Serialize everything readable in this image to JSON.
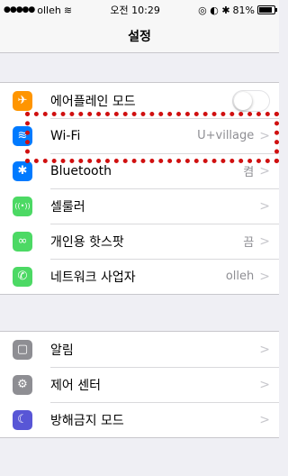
{
  "status_bar": {
    "signal_dots": "●●●●●",
    "carrier": "olleh",
    "wifi_glyph": "≋",
    "time": "오전 10:29",
    "indicators": "◎ ◐ ✱",
    "battery_percent": "81%"
  },
  "nav": {
    "title": "설정"
  },
  "group1": [
    {
      "label": "에어플레인 모드",
      "value": "",
      "icon": "airplane-icon",
      "icon_glyph": "✈",
      "color": "#ff9500",
      "toggle": true
    },
    {
      "label": "Wi-Fi",
      "value": "U+village",
      "icon": "wifi-icon",
      "icon_glyph": "≋",
      "color": "#007aff"
    },
    {
      "label": "Bluetooth",
      "value": "켬",
      "icon": "bluetooth-icon",
      "icon_glyph": "✱",
      "color": "#007aff"
    },
    {
      "label": "셀룰러",
      "value": "",
      "icon": "cellular-icon",
      "icon_glyph": "((•))",
      "color": "#4cd964"
    },
    {
      "label": "개인용 핫스팟",
      "value": "끔",
      "icon": "hotspot-icon",
      "icon_glyph": "∞",
      "color": "#4cd964"
    },
    {
      "label": "네트워크 사업자",
      "value": "olleh",
      "icon": "phone-icon",
      "icon_glyph": "✆",
      "color": "#4cd964"
    }
  ],
  "group2": [
    {
      "label": "알림",
      "value": "",
      "icon": "notifications-icon",
      "icon_glyph": "▢",
      "color": "#8e8e93"
    },
    {
      "label": "제어 센터",
      "value": "",
      "icon": "control-center-icon",
      "icon_glyph": "⚙",
      "color": "#8e8e93"
    },
    {
      "label": "방해금지 모드",
      "value": "",
      "icon": "do-not-disturb-icon",
      "icon_glyph": "☾",
      "color": "#5856d6"
    }
  ],
  "chevron": ">",
  "highlight_color": "#d01010"
}
